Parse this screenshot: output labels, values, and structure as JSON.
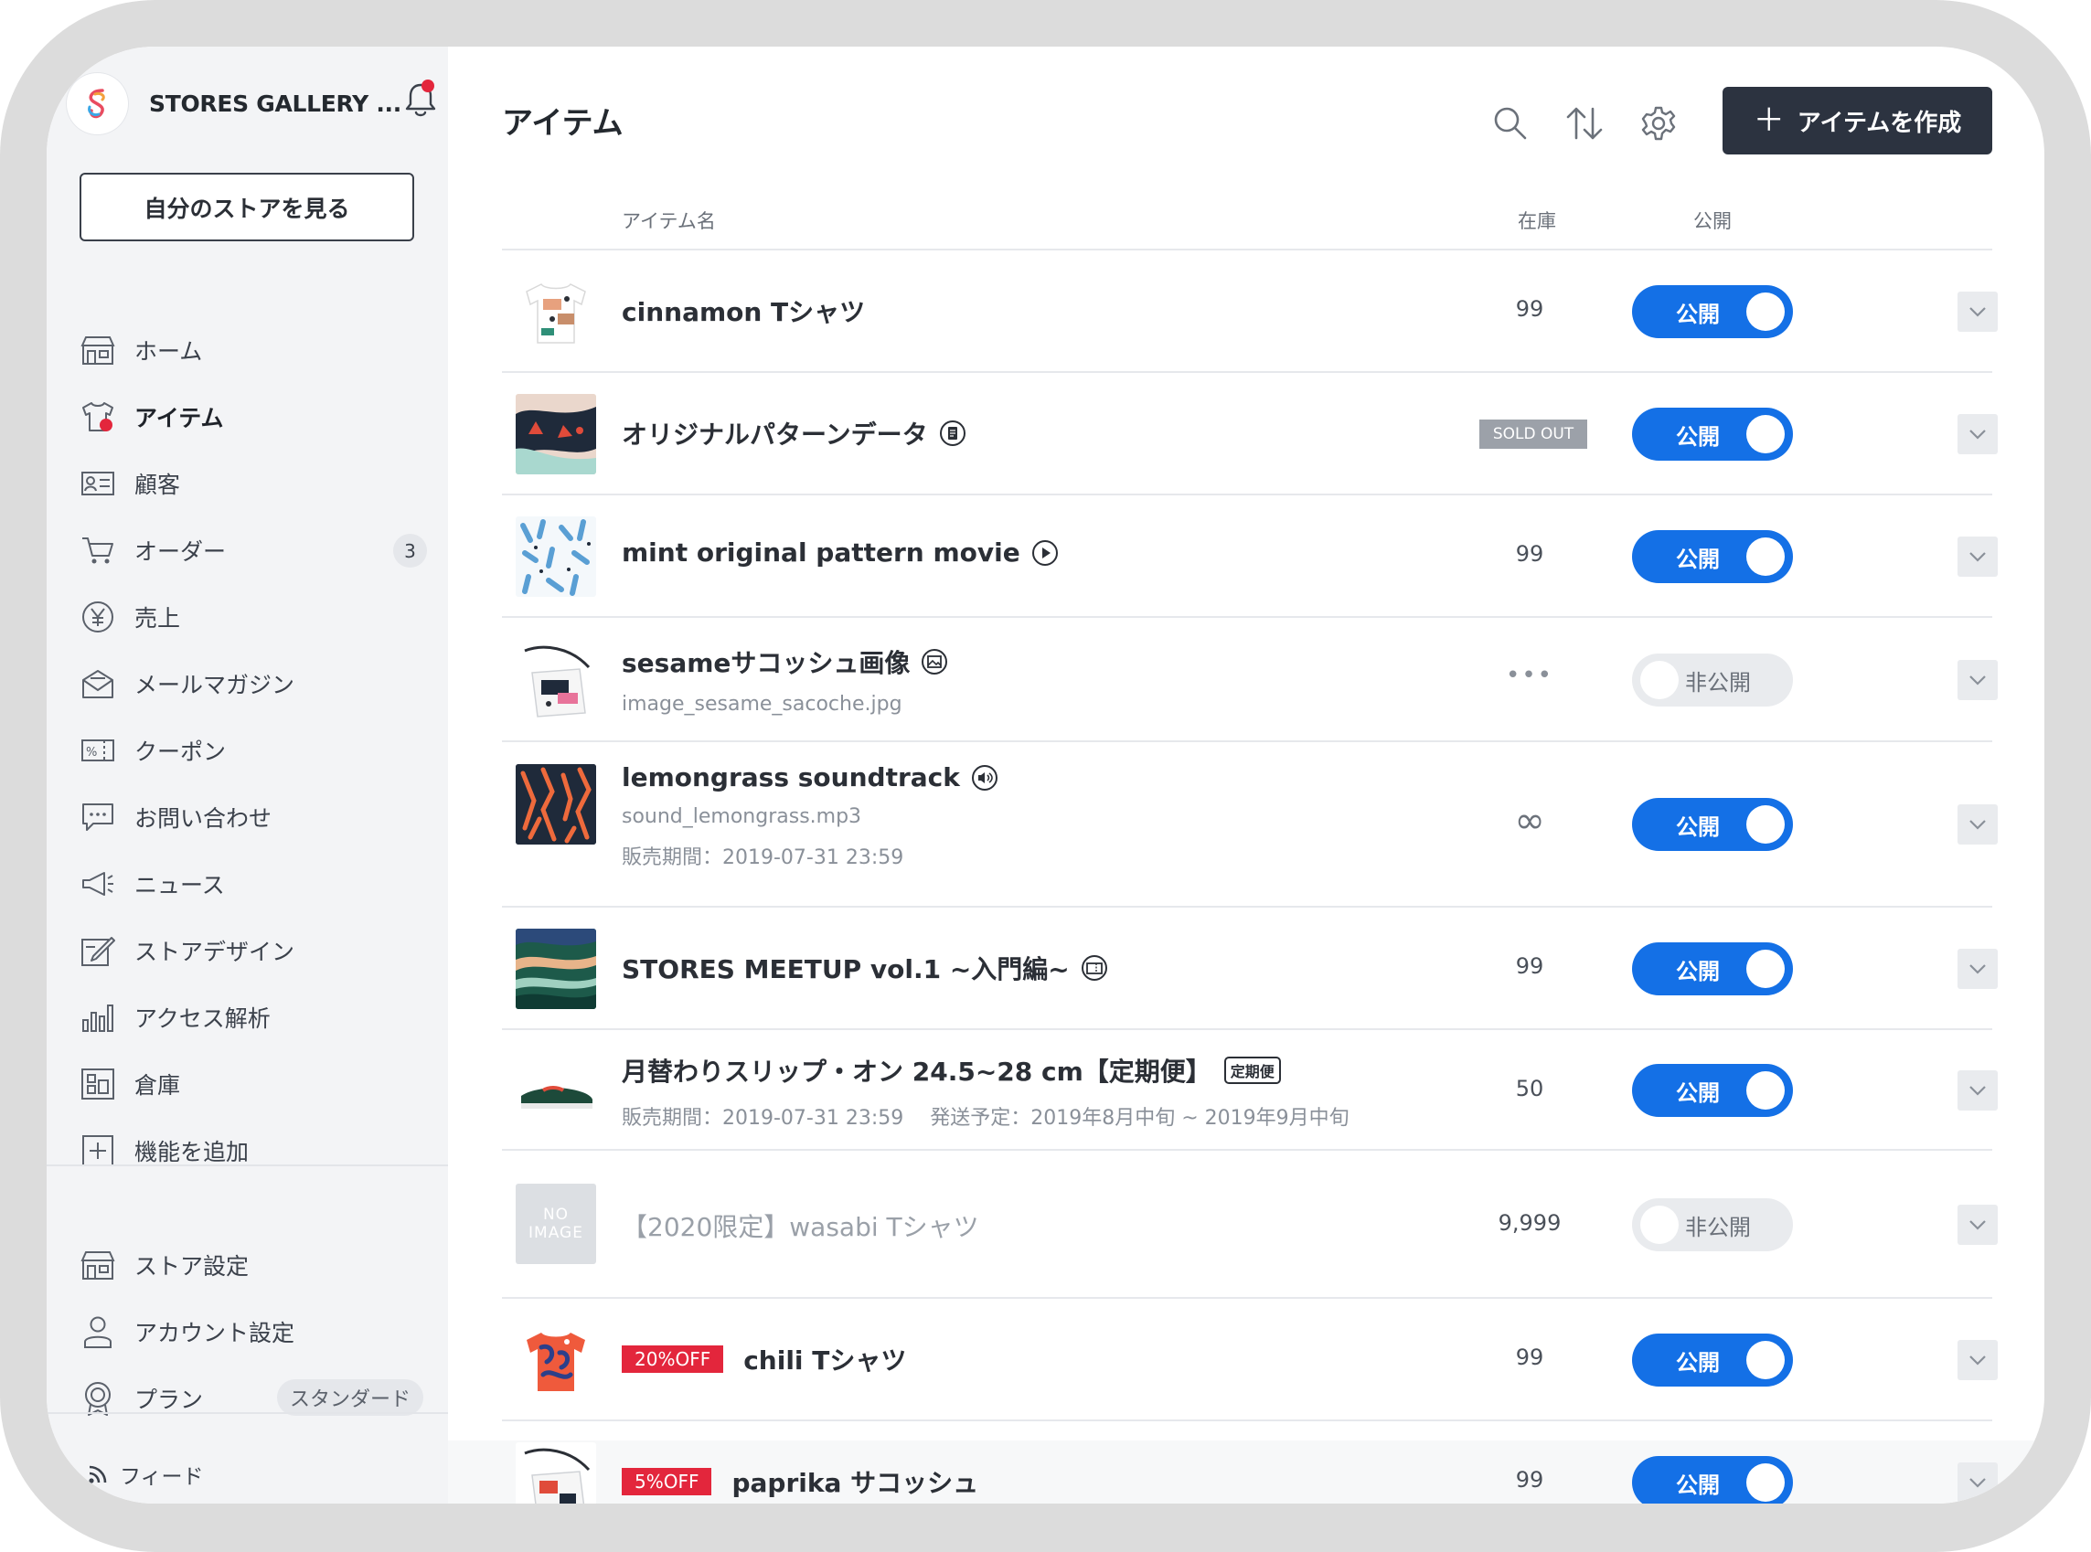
{
  "store": {
    "name": "STORES GALLERY ...",
    "view_store_label": "自分のストアを見る"
  },
  "sidebar": {
    "items": [
      {
        "label": "ホーム",
        "icon": "store-icon"
      },
      {
        "label": "アイテム",
        "icon": "shirt-icon",
        "active": true
      },
      {
        "label": "顧客",
        "icon": "customer-card-icon"
      },
      {
        "label": "オーダー",
        "icon": "cart-icon",
        "count": "3"
      },
      {
        "label": "売上",
        "icon": "yen-icon"
      },
      {
        "label": "メールマガジン",
        "icon": "mail-icon"
      },
      {
        "label": "クーポン",
        "icon": "coupon-icon"
      },
      {
        "label": "お問い合わせ",
        "icon": "chat-icon"
      },
      {
        "label": "ニュース",
        "icon": "megaphone-icon"
      },
      {
        "label": "ストアデザイン",
        "icon": "design-icon"
      },
      {
        "label": "アクセス解析",
        "icon": "chart-icon"
      },
      {
        "label": "倉庫",
        "icon": "warehouse-icon"
      },
      {
        "label": "機能を追加",
        "icon": "plus-box-icon"
      }
    ],
    "settings": [
      {
        "label": "ストア設定",
        "icon": "store-icon"
      },
      {
        "label": "アカウント設定",
        "icon": "person-icon"
      },
      {
        "label": "プラン",
        "icon": "badge-icon",
        "plan": "スタンダード"
      }
    ],
    "feed_label": "フィード"
  },
  "header": {
    "title": "アイテム",
    "create_label": "アイテムを作成"
  },
  "table": {
    "columns": {
      "name": "アイテム名",
      "stock": "在庫",
      "publish": "公開"
    },
    "rows": [
      {
        "name": "cinnamon Tシャツ",
        "stock": "99",
        "status": "公開",
        "on": true
      },
      {
        "name": "オリジナルパターンデータ",
        "type_icon": "file-icon",
        "stock_badge": "SOLD OUT",
        "status": "公開",
        "on": true
      },
      {
        "name": "mint original pattern movie",
        "type_icon": "play-icon",
        "stock": "99",
        "status": "公開",
        "on": true
      },
      {
        "name": "sesameサコッシュ画像",
        "type_icon": "image-icon",
        "sub": "image_sesame_sacoche.jpg",
        "stock": "•••",
        "status": "非公開",
        "on": false
      },
      {
        "name": "lemongrass soundtrack",
        "type_icon": "sound-icon",
        "sub": "sound_lemongrass.mp3",
        "sub2": "販売期間：2019-07-31 23:59",
        "stock": "∞",
        "status": "公開",
        "on": true
      },
      {
        "name": "STORES MEETUP vol.1 ~入門編~",
        "type_icon": "ticket-icon",
        "stock": "99",
        "status": "公開",
        "on": true
      },
      {
        "name": "月替わりスリップ・オン 24.5~28 cm【定期便】",
        "tag": "定期便",
        "sub": "販売期間：2019-07-31 23:59　 発送予定：2019年8月中旬 ~ 2019年9月中旬",
        "stock": "50",
        "status": "公開",
        "on": true
      },
      {
        "name": "【2020限定】wasabi Tシャツ",
        "thumb_text_1": "NO",
        "thumb_text_2": "IMAGE",
        "stock": "9,999",
        "status": "非公開",
        "on": false
      },
      {
        "name": "chili Tシャツ",
        "discount": "20%OFF",
        "stock": "99",
        "status": "公開",
        "on": true
      },
      {
        "name": "paprika サコッシュ",
        "discount": "5%OFF",
        "stock": "99",
        "status": "公開",
        "on": true
      }
    ]
  },
  "colors": {
    "accent": "#1470e6",
    "dark": "#2c3340",
    "sale": "#e3263c"
  }
}
